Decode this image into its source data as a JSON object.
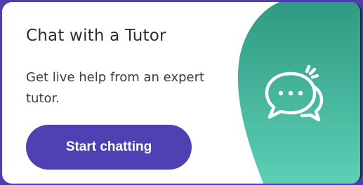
{
  "card": {
    "title": "Chat with a Tutor",
    "description": "Get live help from an expert tutor.",
    "button_label": "Start chatting"
  },
  "icon": {
    "name": "chat-bubbles-icon"
  },
  "colors": {
    "frame": "#4e3fae",
    "button": "#4d41b3",
    "blob_top": "#2f9a82",
    "blob_bottom": "#5ccfb5",
    "text": "#2d2d3a"
  }
}
